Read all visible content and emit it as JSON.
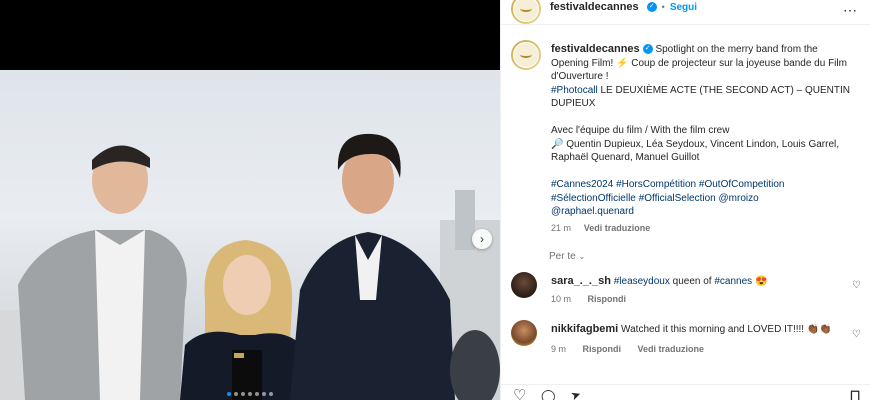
{
  "header": {
    "username": "festivaldecannes",
    "separator": "•",
    "follow_label": "Segui",
    "more_icon": "⋯"
  },
  "caption": {
    "username": "festivaldecannes",
    "line1": "Spotlight on the merry band from the Opening Film!",
    "line1_emoji": "⚡",
    "line1_rest": "Coup de projecteur sur la joyeuse bande du Film d'Ouverture !",
    "photocall_tag": "#Photocall",
    "photocall_text": "LE DEUXIÈME ACTE (THE SECOND ACT) – QUENTIN DUPIEUX",
    "crew_intro": "Avec l'équipe du film / With the film crew",
    "crew_emoji": "🔎",
    "crew_list": "Quentin Dupieux, Léa Seydoux, Vincent Lindon, Louis Garrel, Raphaël Quenard, Manuel Guillot",
    "hashtags_line1": [
      "#Cannes2024",
      "#HorsCompétition",
      "#OutOfCompetition"
    ],
    "hashtags_line2": [
      "#SélectionOfficielle",
      "#OfficialSelection",
      "@mroizo"
    ],
    "mention_line3": "@raphael.quenard",
    "time": "21 m",
    "translate": "Vedi traduzione"
  },
  "for_you": "Per te",
  "comments": [
    {
      "username": "sara_._._sh",
      "tag": "#leaseydoux",
      "text_mid": "queen of",
      "tag2": "#cannes",
      "emoji": "😍",
      "time": "10 m",
      "reply": "Rispondi"
    },
    {
      "username": "nikkifagbemi",
      "text": "Watched it this morning and LOVED IT!!!!",
      "emoji": "👏🏾👏🏾",
      "time": "9 m",
      "reply": "Rispondi",
      "translate": "Vedi traduzione"
    }
  ],
  "icons": {
    "heart": "♡",
    "comment": "◯",
    "share": "➤",
    "save": "⊓",
    "next": "›"
  },
  "colors": {
    "accent": "#0095f6",
    "link": "#00376b",
    "muted": "#737373"
  },
  "carousel": {
    "count": 7,
    "active": 0
  }
}
